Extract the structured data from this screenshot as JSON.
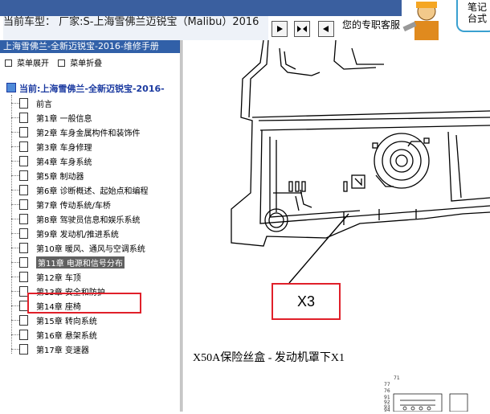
{
  "topbar": {
    "vehicle_label": "当前车型： 厂家:S-上海雪佛兰迈锐宝（Malibu）2016",
    "tagline": "您的专职客服",
    "bubble_text": "笔记\n台式"
  },
  "sidebar": {
    "manual_title": "上海雪佛兰-全新迈锐宝-2016-维修手册",
    "expand_label": "菜单展开",
    "collapse_label": "菜单折叠",
    "current_label": "当前:上海雪佛兰-全新迈锐宝-2016-",
    "items": [
      {
        "label": "前言"
      },
      {
        "label": "第1章 一般信息"
      },
      {
        "label": "第2章 车身金属构件和装饰件"
      },
      {
        "label": "第3章 车身修理"
      },
      {
        "label": "第4章 车身系统"
      },
      {
        "label": "第5章 制动器"
      },
      {
        "label": "第6章 诊断概述、起始点和编程"
      },
      {
        "label": "第7章 传动系统/车桥"
      },
      {
        "label": "第8章 驾驶员信息和娱乐系统"
      },
      {
        "label": "第9章 发动机/推进系统"
      },
      {
        "label": "第10章 暖风、通风与空调系统"
      },
      {
        "label": "第11章 电源和信号分布"
      },
      {
        "label": "第12章 车顶"
      },
      {
        "label": "第13章 安全和防护"
      },
      {
        "label": "第14章 座椅"
      },
      {
        "label": "第15章 转向系统"
      },
      {
        "label": "第16章 悬架系统"
      },
      {
        "label": "第17章 变速器"
      }
    ]
  },
  "diagram": {
    "callout_label": "X3",
    "caption": "X50A保险丝盒 - 发动机罩下X1",
    "mini_numbers": [
      "71",
      "77",
      "76",
      "91",
      "92",
      "93",
      "94"
    ]
  }
}
